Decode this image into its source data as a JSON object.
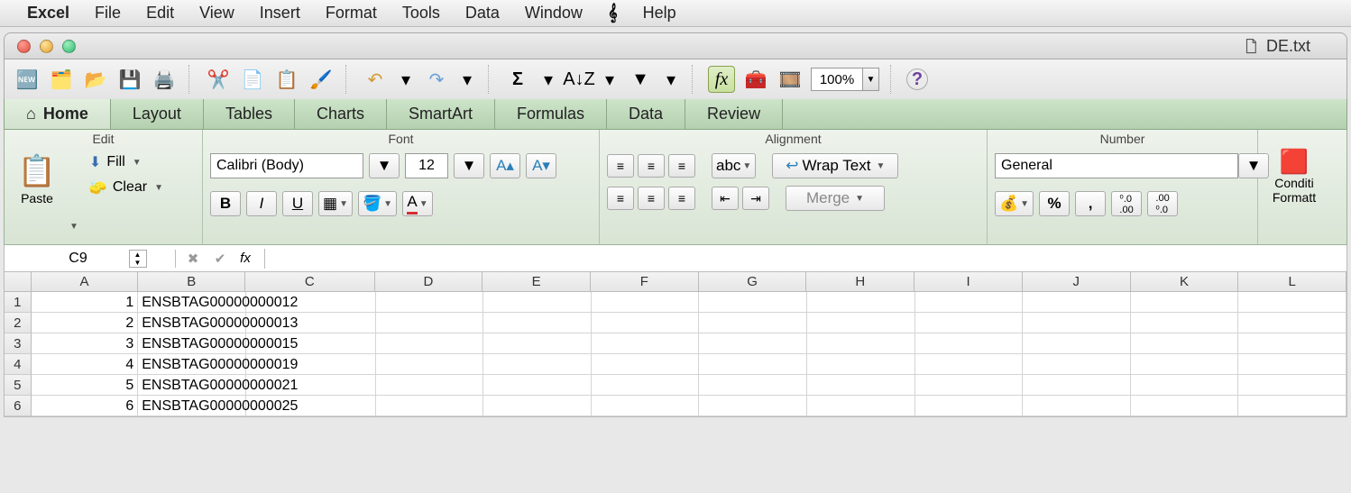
{
  "menubar": {
    "app": "Excel",
    "items": [
      "File",
      "Edit",
      "View",
      "Insert",
      "Format",
      "Tools",
      "Data",
      "Window"
    ],
    "help": "Help"
  },
  "window": {
    "title": "DE.txt"
  },
  "toolbar": {
    "zoom": "100%"
  },
  "ribbon": {
    "tabs": [
      "Home",
      "Layout",
      "Tables",
      "Charts",
      "SmartArt",
      "Formulas",
      "Data",
      "Review"
    ],
    "active_tab": "Home",
    "groups": {
      "edit": {
        "title": "Edit",
        "paste": "Paste",
        "fill": "Fill",
        "clear": "Clear"
      },
      "font": {
        "title": "Font",
        "name": "Calibri (Body)",
        "size": "12",
        "increase": "A▴",
        "decrease": "A▾",
        "bold": "B",
        "italic": "I",
        "underline": "U"
      },
      "alignment": {
        "title": "Alignment",
        "orientation": "abc",
        "wrap": "Wrap Text",
        "merge": "Merge"
      },
      "number": {
        "title": "Number",
        "format": "General",
        "percent": "%",
        "comma": ",",
        "inc_dec": "",
        "dec_dec": ""
      },
      "cond": {
        "line1": "Conditi",
        "line2": "Formatt"
      }
    }
  },
  "namebox": {
    "ref": "C9"
  },
  "formula": {
    "value": ""
  },
  "grid": {
    "columns": [
      "A",
      "B",
      "C",
      "D",
      "E",
      "F",
      "G",
      "H",
      "I",
      "J",
      "K",
      "L"
    ],
    "rows": [
      {
        "n": "1",
        "A": "1",
        "B": "ENSBTAG00000000012"
      },
      {
        "n": "2",
        "A": "2",
        "B": "ENSBTAG00000000013"
      },
      {
        "n": "3",
        "A": "3",
        "B": "ENSBTAG00000000015"
      },
      {
        "n": "4",
        "A": "4",
        "B": "ENSBTAG00000000019"
      },
      {
        "n": "5",
        "A": "5",
        "B": "ENSBTAG00000000021"
      },
      {
        "n": "6",
        "A": "6",
        "B": "ENSBTAG00000000025"
      }
    ]
  }
}
